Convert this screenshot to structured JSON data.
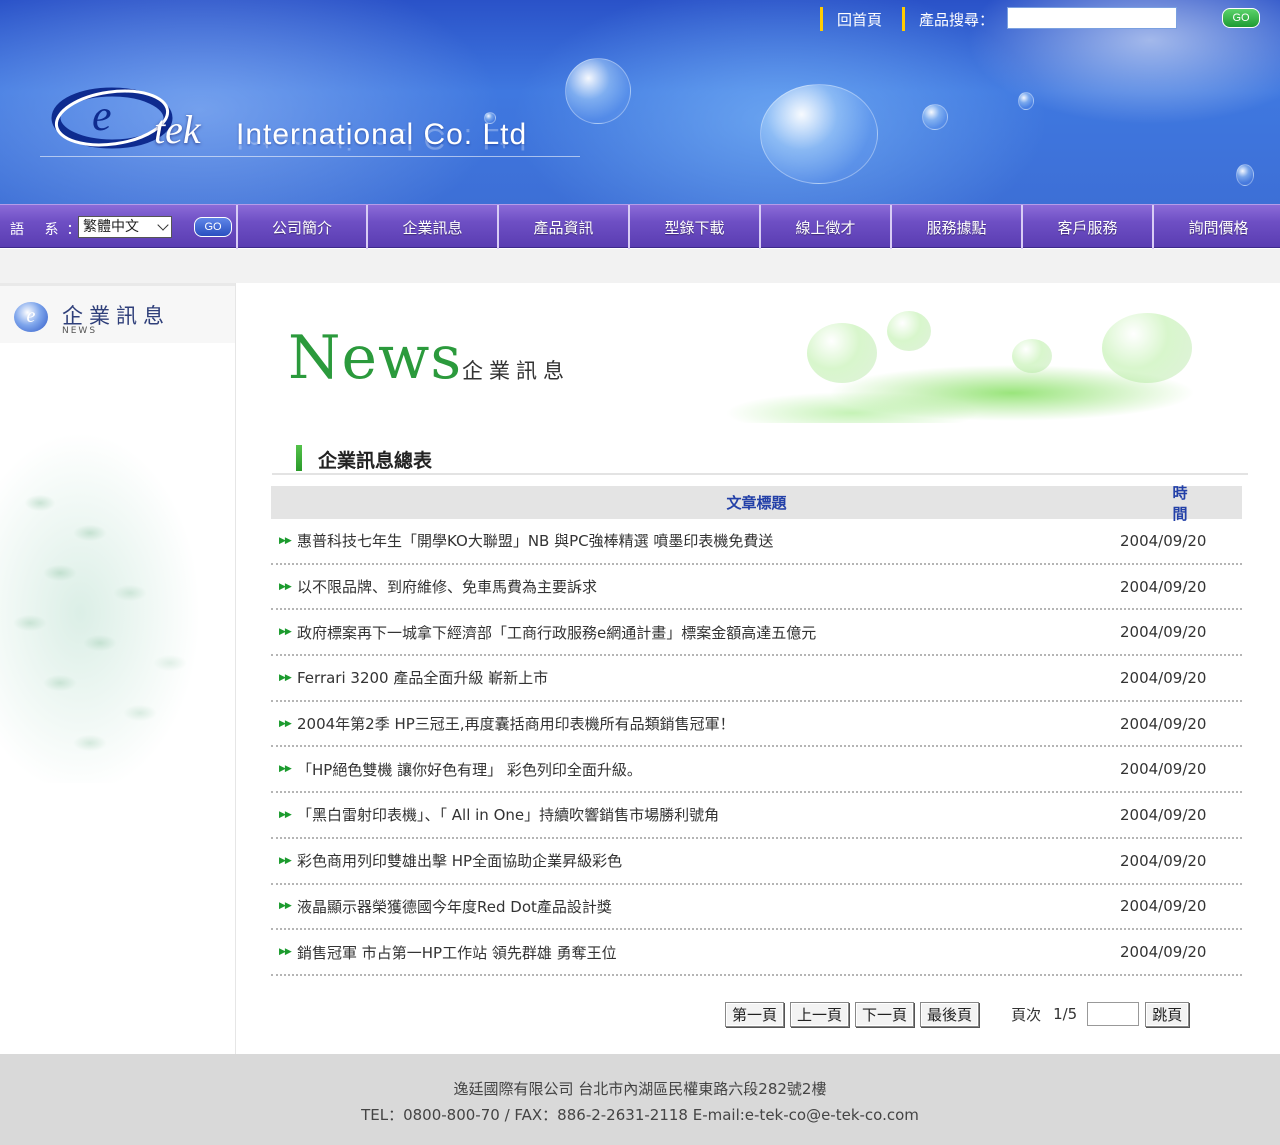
{
  "header": {
    "company_name": "International Co. Ltd",
    "logo_mark": "tek",
    "home_link": "回首頁",
    "search_label": "產品搜尋：",
    "search_value": "",
    "go_label": "GO"
  },
  "nav": {
    "language_label": "語 系：",
    "language_selected": "繁體中文",
    "go_label": "GO",
    "items": [
      {
        "label": "公司簡介"
      },
      {
        "label": "企業訊息"
      },
      {
        "label": "產品資訊"
      },
      {
        "label": "型錄下載"
      },
      {
        "label": "線上徵才"
      },
      {
        "label": "服務據點"
      },
      {
        "label": "客戶服務"
      },
      {
        "label": "詢問價格"
      }
    ]
  },
  "sidebar": {
    "logo_mark": "e",
    "title": "企業訊息",
    "subtitle": "NEWS"
  },
  "main": {
    "banner_word": "News",
    "banner_cn": "企業訊息",
    "section_title": "企業訊息總表",
    "table": {
      "col_title": "文章標題",
      "col_time": "時間",
      "rows": [
        {
          "title": "惠普科技七年生「開學KO大聯盟」NB 與PC強棒精選 噴墨印表機免費送",
          "date": "2004/09/20"
        },
        {
          "title": "以不限品牌、到府維修、免車馬費為主要訴求",
          "date": "2004/09/20"
        },
        {
          "title": "政府標案再下一城拿下經濟部「工商行政服務e網通計畫」標案金額高達五億元",
          "date": "2004/09/20"
        },
        {
          "title": "Ferrari 3200 產品全面升級 嶄新上市",
          "date": "2004/09/20"
        },
        {
          "title": " 2004年第2季 HP三冠王,再度囊括商用印表機所有品類銷售冠軍！",
          "date": "2004/09/20"
        },
        {
          "title": "「HP絕色雙機 讓你好色有理」 彩色列印全面升級。",
          "date": "2004/09/20"
        },
        {
          "title": "「黑白雷射印表機」、「 All in One」持續吹響銷售市場勝利號角",
          "date": "2004/09/20"
        },
        {
          "title": "彩色商用列印雙雄出擊 HP全面協助企業昇級彩色",
          "date": "2004/09/20"
        },
        {
          "title": "液晶顯示器榮獲德國今年度Red Dot產品設計獎",
          "date": "2004/09/20"
        },
        {
          "title": "銷售冠軍 市占第一HP工作站 領先群雄 勇奪王位",
          "date": "2004/09/20"
        }
      ]
    },
    "pager": {
      "first": "第一頁",
      "prev": "上一頁",
      "next": "下一頁",
      "last": "最後頁",
      "page_label": "頁次",
      "page_value": "1/5",
      "jump_value": "",
      "jump": "跳頁"
    }
  },
  "footer": {
    "line1": "逸廷國際有限公司 台北市內湖區民權東路六段282號2樓",
    "line2": "TEL：0800-800-70 / FAX：886-2-2631-2118 E-mail:e-tek-co@e-tek-co.com"
  },
  "colors": {
    "header_blue": "#3f78e0",
    "nav_purple": "#6e4fc4",
    "accent_green": "#2b9a3c",
    "table_header_text": "#2340a8",
    "footer_bg": "#d9d9d9"
  }
}
